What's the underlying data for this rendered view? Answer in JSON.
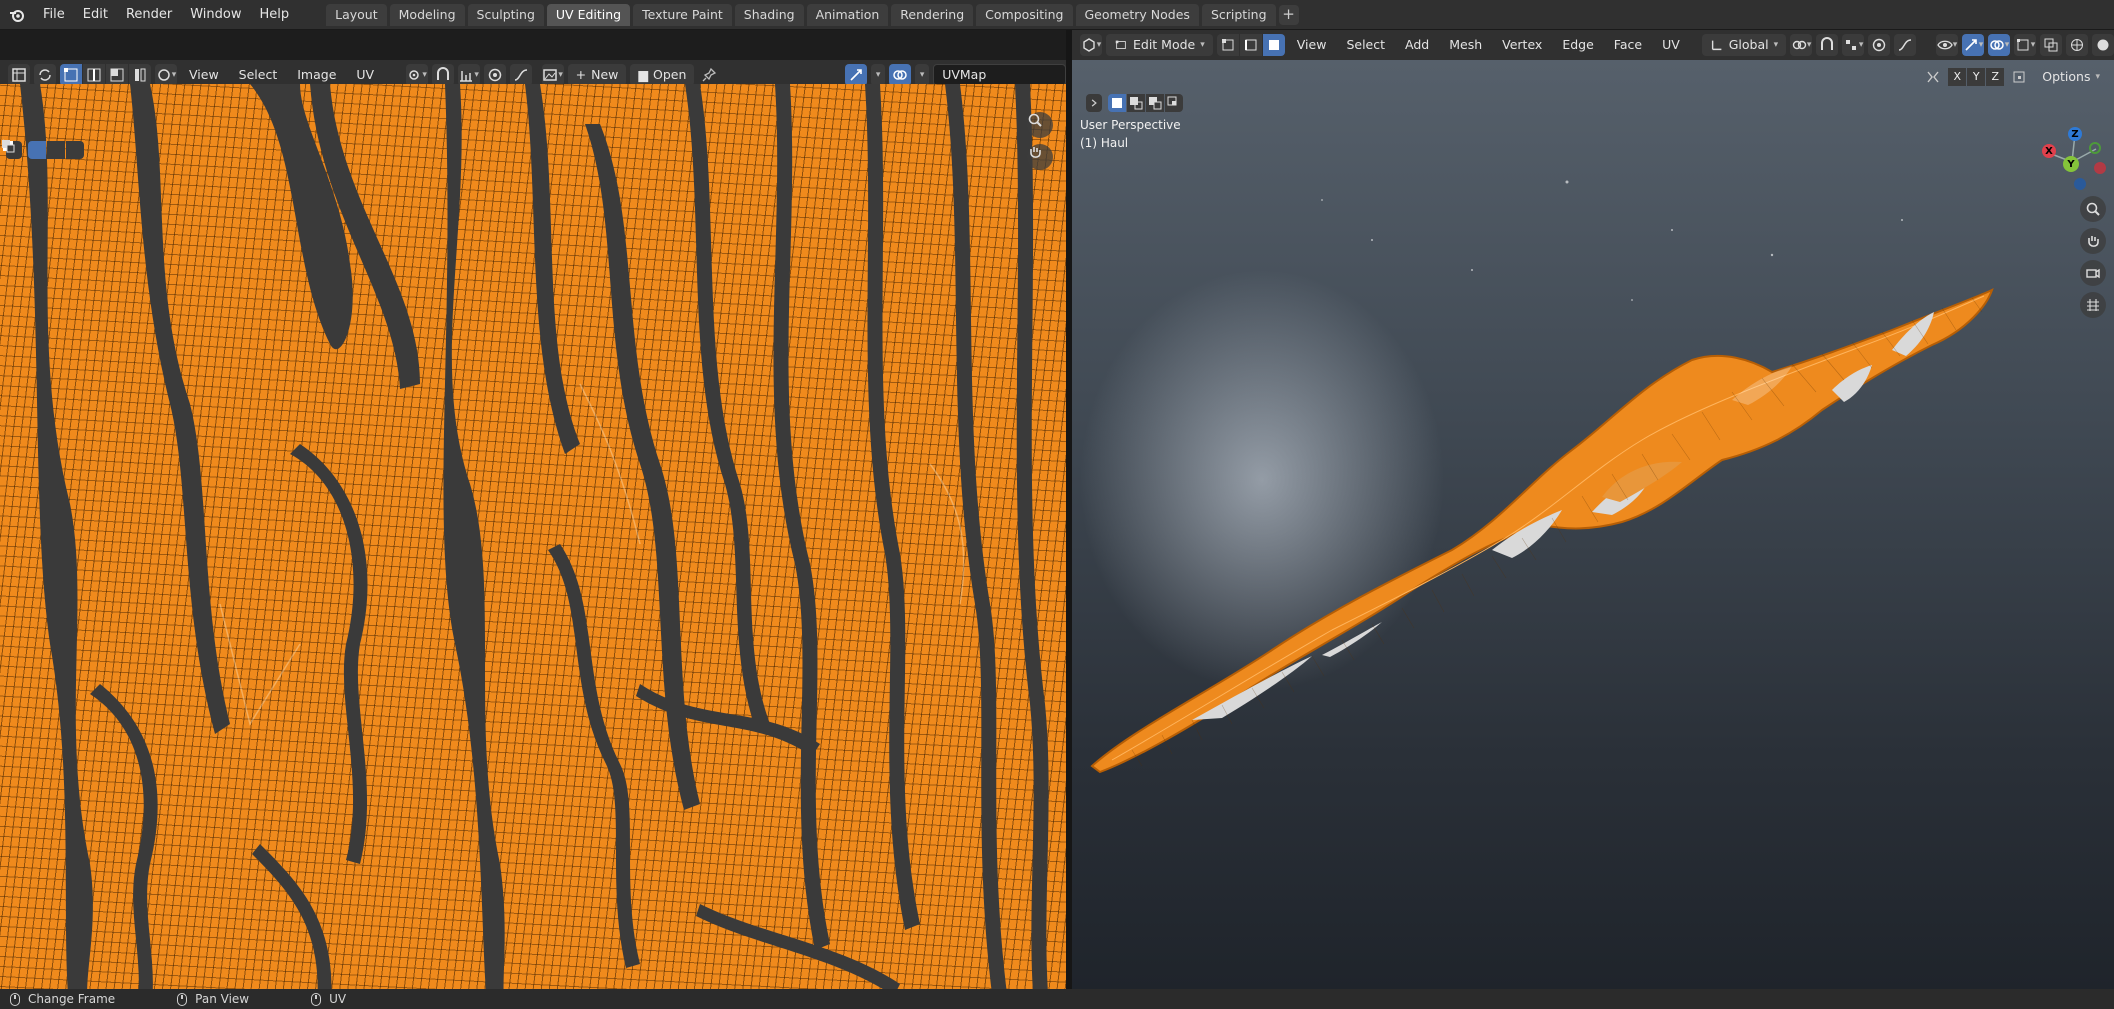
{
  "menu": {
    "file": "File",
    "edit": "Edit",
    "render": "Render",
    "window": "Window",
    "help": "Help"
  },
  "workspaces": [
    {
      "label": "Layout",
      "active": false
    },
    {
      "label": "Modeling",
      "active": false
    },
    {
      "label": "Sculpting",
      "active": false
    },
    {
      "label": "UV Editing",
      "active": true
    },
    {
      "label": "Texture Paint",
      "active": false
    },
    {
      "label": "Shading",
      "active": false
    },
    {
      "label": "Animation",
      "active": false
    },
    {
      "label": "Rendering",
      "active": false
    },
    {
      "label": "Compositing",
      "active": false
    },
    {
      "label": "Geometry Nodes",
      "active": false
    },
    {
      "label": "Scripting",
      "active": false
    }
  ],
  "uv_editor": {
    "menus": {
      "view": "View",
      "select": "Select",
      "image": "Image",
      "uv": "UV"
    },
    "new_label": "New",
    "open_label": "Open",
    "uvmap_name": "UVMap"
  },
  "viewport": {
    "mode": "Edit Mode",
    "menus": {
      "view": "View",
      "select": "Select",
      "add": "Add",
      "mesh": "Mesh",
      "vertex": "Vertex",
      "edge": "Edge",
      "face": "Face",
      "uv": "UV"
    },
    "orientation": "Global",
    "options_label": "Options",
    "axes": {
      "x": "X",
      "y": "Y",
      "z": "Z"
    },
    "perspective_label": "User Perspective",
    "object_label": "(1) Haul",
    "gizmo": {
      "x": "X",
      "y": "Y",
      "z": "Z"
    }
  },
  "statusbar": {
    "items": [
      {
        "label": "Change Frame",
        "icon": "mouse-left-icon"
      },
      {
        "label": "Pan View",
        "icon": "mouse-middle-icon"
      },
      {
        "label": "UV",
        "icon": "mouse-right-icon"
      }
    ]
  },
  "colors": {
    "accent": "#4772b3",
    "uv_orange": "#f08a1c",
    "uv_bg": "#3a3a3a",
    "header": "#303030"
  }
}
